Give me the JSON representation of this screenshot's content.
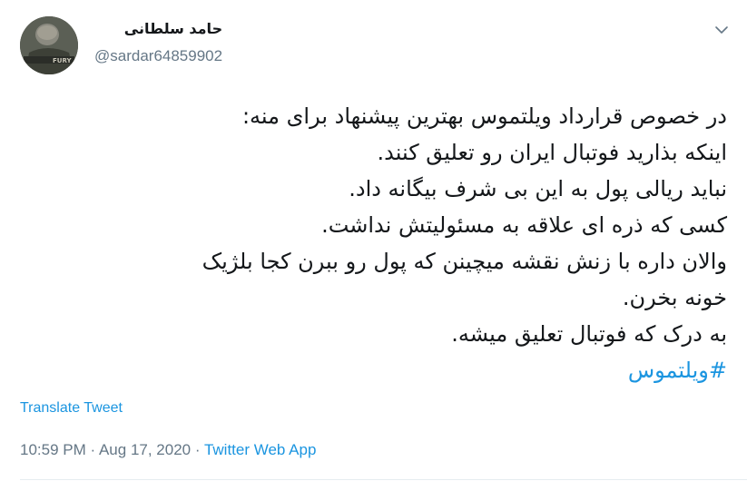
{
  "tweet": {
    "author": {
      "display_name": "حامد سلطانی",
      "handle": "@sardar64859902"
    },
    "body_lines": [
      "در خصوص قرارداد ویلتموس بهترین پیشنهاد برای منه:",
      "اینکه بذارید فوتبال ایران رو تعلیق کنند.",
      "نباید ریالی پول به این بی شرف بیگانه داد.",
      "کسی که ذره ای علاقه به مسئولیتش نداشت.",
      "والان داره با زنش نقشه میچینن که پول رو ببرن کجا بلژیک",
      "خونه بخرن.",
      "به درک که فوتبال تعلیق میشه."
    ],
    "hashtag": "#ویلتموس",
    "translate_label": "Translate Tweet",
    "time": "10:59 PM",
    "separator": "·",
    "date": "Aug 17, 2020",
    "source": "Twitter Web App"
  },
  "icons": {
    "caret": "chevron-down-icon"
  },
  "colors": {
    "link": "#1b95e0",
    "muted": "#657786",
    "text": "#14171a",
    "divider": "#e6ecf0"
  }
}
